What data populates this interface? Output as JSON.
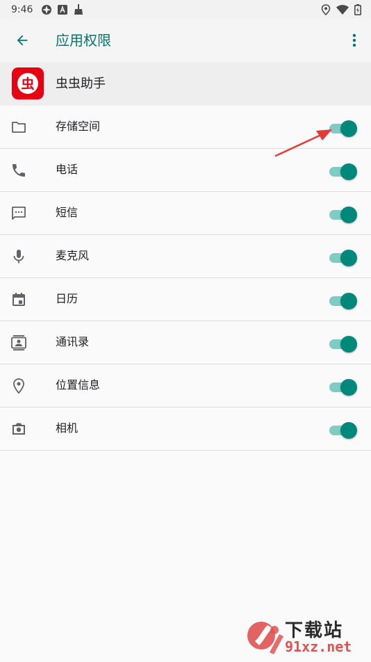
{
  "status_bar": {
    "time": "9:46",
    "left_icons": [
      "photos-icon",
      "font-a-icon",
      "broom-icon"
    ],
    "right_icons": [
      "location-icon",
      "wifi-icon",
      "battery-icon"
    ]
  },
  "app_bar": {
    "title": "应用权限"
  },
  "app_header": {
    "app_name": "虫虫助手",
    "logo_char": "虫"
  },
  "permissions": [
    {
      "label": "存储空间",
      "icon": "folder-icon",
      "enabled": true
    },
    {
      "label": "电话",
      "icon": "phone-icon",
      "enabled": true
    },
    {
      "label": "短信",
      "icon": "sms-icon",
      "enabled": true
    },
    {
      "label": "麦克风",
      "icon": "microphone-icon",
      "enabled": true
    },
    {
      "label": "日历",
      "icon": "calendar-icon",
      "enabled": true
    },
    {
      "label": "通讯录",
      "icon": "contacts-icon",
      "enabled": true
    },
    {
      "label": "位置信息",
      "icon": "location-pin-icon",
      "enabled": true
    },
    {
      "label": "相机",
      "icon": "camera-icon",
      "enabled": true
    }
  ],
  "watermark": {
    "title": "下载站",
    "url": "91xz.net"
  },
  "colors": {
    "accent": "#00796b",
    "toggle_thumb": "#00897b",
    "toggle_track": "#80cbc4",
    "annotation": "#e53935",
    "logo": "#e60012"
  }
}
